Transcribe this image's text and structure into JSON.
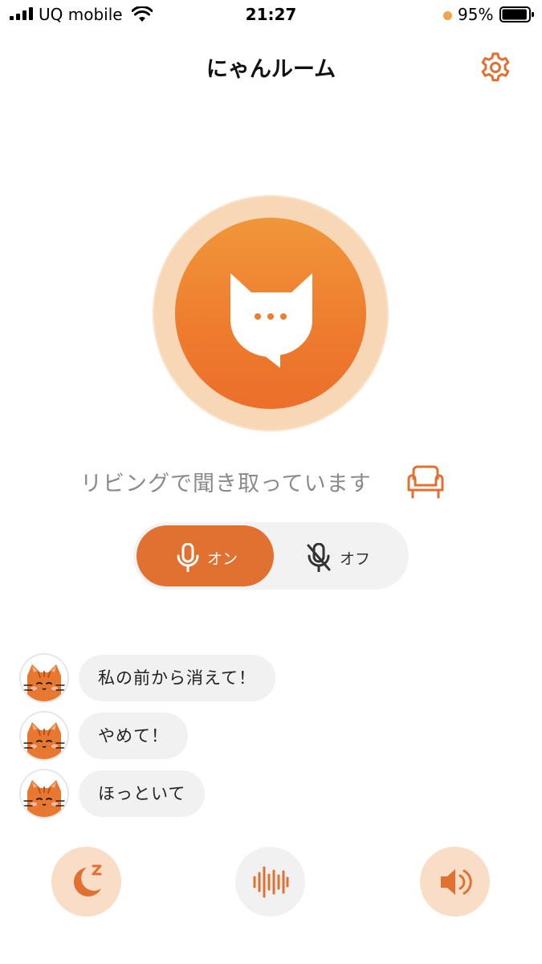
{
  "status_bar": {
    "carrier": "UQ mobile",
    "time": "21:27",
    "battery_percent": "95%",
    "battery_level": 0.95
  },
  "header": {
    "title": "にゃんルーム",
    "settings_icon": "gear-icon"
  },
  "listening": {
    "text": "リビングで聞き取っています",
    "room_icon": "sofa-icon"
  },
  "mic_toggle": {
    "on_label": "オン",
    "off_label": "オフ",
    "selected": "on"
  },
  "messages": [
    {
      "text": "私の前から消えて！",
      "avatar": "cat-face-avatar"
    },
    {
      "text": "やめて！",
      "avatar": "cat-face-avatar"
    },
    {
      "text": "ほっといて",
      "avatar": "cat-face-avatar"
    }
  ],
  "bottom_buttons": [
    {
      "icon": "moon-sleep-icon"
    },
    {
      "icon": "sound-wave-icon"
    },
    {
      "icon": "speaker-icon"
    }
  ],
  "colors": {
    "accent": "#E07131",
    "accent_light": "#FADDC6",
    "ring": "#F8D7B6",
    "battery_dot": "#F2A24A"
  }
}
